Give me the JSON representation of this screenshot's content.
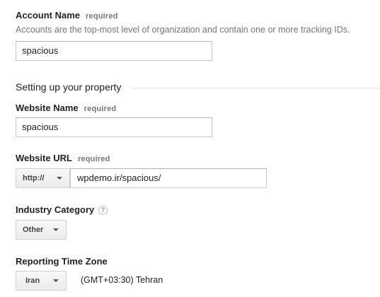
{
  "account": {
    "label": "Account Name",
    "required": "required",
    "help": "Accounts are the top-most level of organization and contain one or more tracking IDs.",
    "value": "spacious"
  },
  "property_section": {
    "title": "Setting up your property"
  },
  "website_name": {
    "label": "Website Name",
    "required": "required",
    "value": "spacious"
  },
  "website_url": {
    "label": "Website URL",
    "required": "required",
    "protocol": "http://",
    "value": "wpdemo.ir/spacious/"
  },
  "industry": {
    "label": "Industry Category",
    "help_icon": "?",
    "value": "Other"
  },
  "timezone": {
    "label": "Reporting Time Zone",
    "country": "Iran",
    "zone": "(GMT+03:30) Tehran"
  }
}
